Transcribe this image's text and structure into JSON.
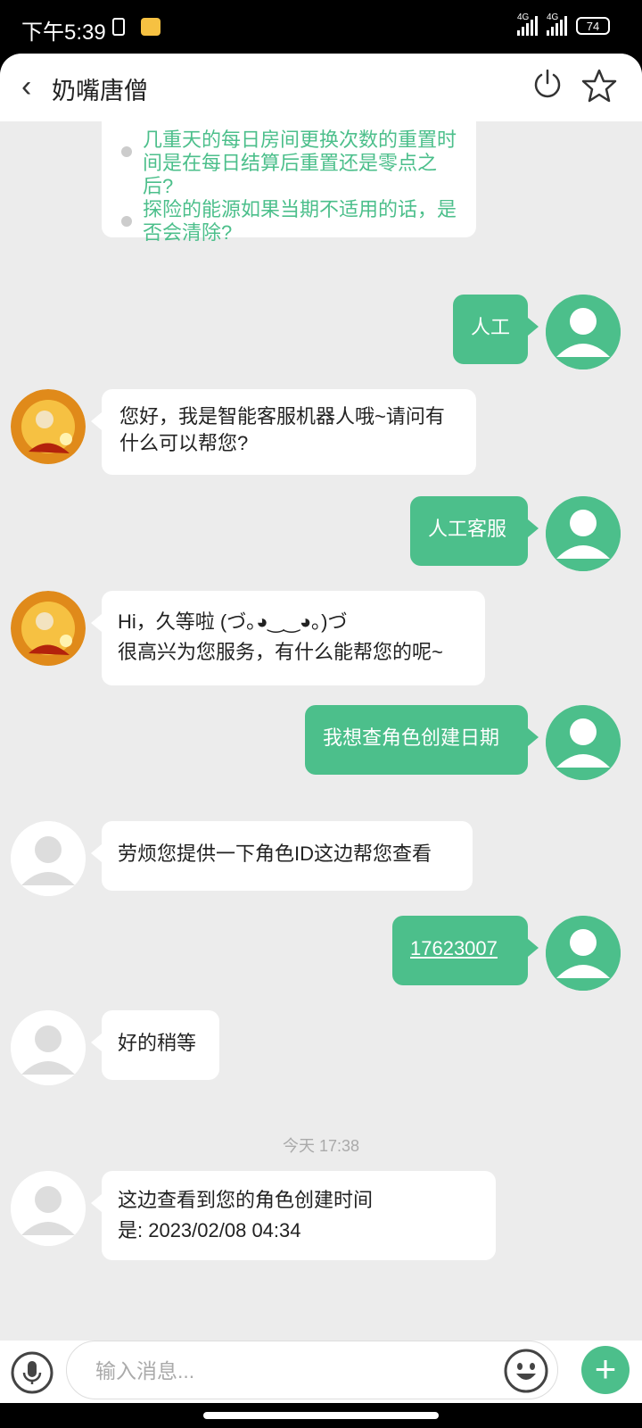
{
  "status_bar": {
    "time": "下午5:39",
    "network_1": "4G",
    "network_2": "4G",
    "battery": "74"
  },
  "header": {
    "back_icon": "‹",
    "title": "奶嘴唐僧"
  },
  "messages": {
    "q1": "几重天的每日房间更换次数的重置时间是在每日结算后重置还是零点之后?",
    "q2": "探险的能源如果当期不适用的话，是否会清除?",
    "m1": "人工",
    "m2": "您好，我是智能客服机器人哦~请问有什么可以帮您?",
    "m3": "人工客服",
    "m4_line1": "Hi，久等啦 (づ｡◕‿‿◕｡)づ",
    "m4_line2": "很高兴为您服务，有什么能帮您的呢~",
    "m5": "我想查角色创建日期",
    "m6": "劳烦您提供一下角色ID这边帮您查看",
    "m7": "17623007",
    "m8": "好的稍等",
    "timestamp": "今天 17:38",
    "m9_line1": "这边查看到您的角色创建时间",
    "m9_line2": "是: 2023/02/08 04:34"
  },
  "input": {
    "placeholder": "输入消息..."
  },
  "colors": {
    "accent": "#4cbf8b",
    "background": "#ececec"
  }
}
